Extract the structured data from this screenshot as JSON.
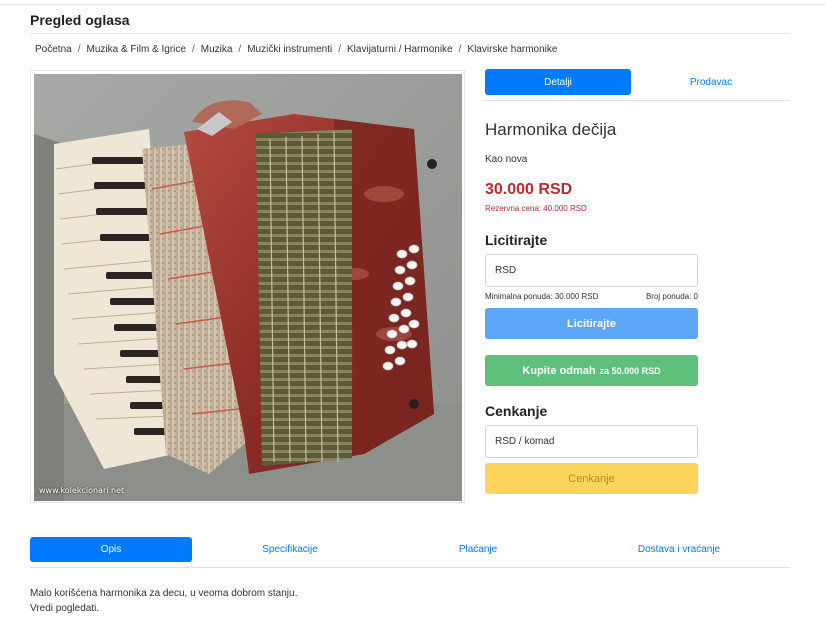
{
  "page": {
    "title": "Pregled oglasa"
  },
  "breadcrumb": [
    "Početna",
    "Muzika & Film & Igrice",
    "Muzika",
    "Muzički instrumenti",
    "Klavijaturni / Harmonike",
    "Klavirske harmonike"
  ],
  "photo": {
    "watermark": "www.kolekcionari.net"
  },
  "tabs": {
    "details": "Detalji",
    "seller": "Prodavac"
  },
  "product": {
    "title": "Harmonika dečija",
    "condition": "Kao nova",
    "price": "30.000 RSD",
    "reserve_price": "Rezervna cena: 40.000 RSD"
  },
  "bidding": {
    "heading": "Licitirajte",
    "input_placeholder": "RSD",
    "min_bid": "Minimalna ponuda: 30.000 RSD",
    "bid_count": "Broj ponuda: 0",
    "bid_button": "Licitirajte"
  },
  "buy_now": {
    "label": "Kupite odmah",
    "suffix": "za 50.000 RSD"
  },
  "haggle": {
    "heading": "Cenkanje",
    "input_placeholder": "RSD / komad",
    "button": "Cenkanje"
  },
  "bottom_tabs": [
    "Opis",
    "Specifikacije",
    "Plaćanje",
    "Dostava i vraćanje"
  ],
  "description": [
    "Malo korišćena harmonika za decu, u veoma dobrom stanju.",
    "Vredi pogledati."
  ],
  "colors": {
    "primary": "#007bff",
    "price": "#c0282d",
    "success": "#5ec07a",
    "warning": "#fdd55b"
  }
}
